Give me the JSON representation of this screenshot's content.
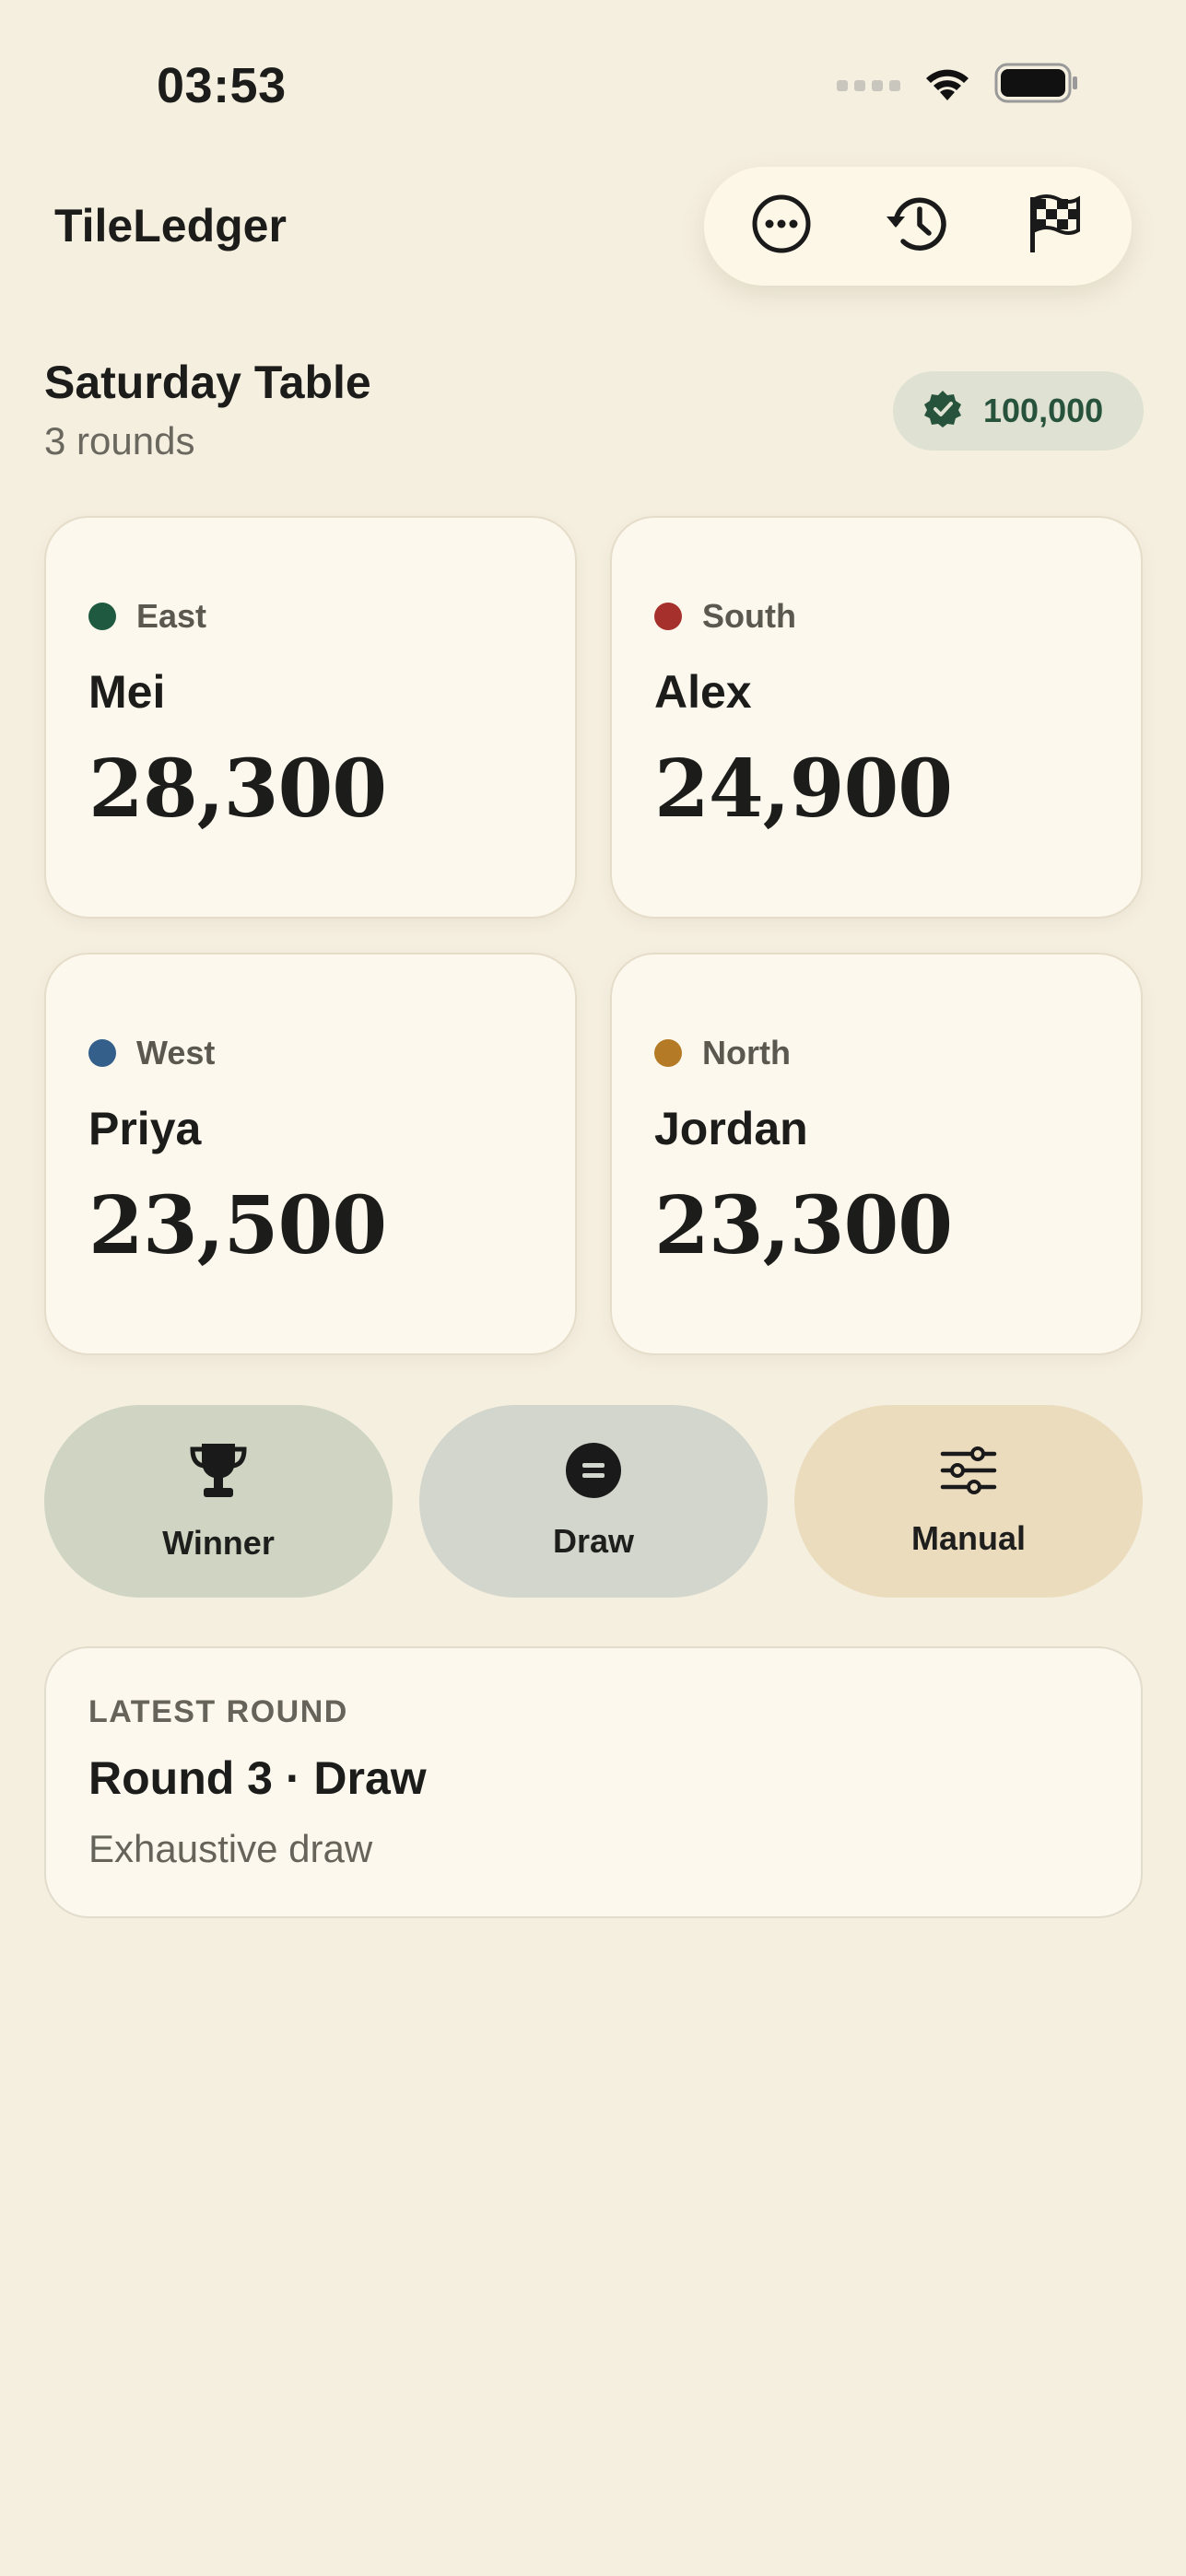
{
  "status_bar": {
    "time": "03:53"
  },
  "header": {
    "app_title": "TileLedger",
    "actions": [
      {
        "icon": "more-icon"
      },
      {
        "icon": "history-icon"
      },
      {
        "icon": "checkered-flag-icon"
      }
    ]
  },
  "session": {
    "title": "Saturday Table",
    "subtitle": "3 rounds",
    "target_badge": {
      "icon": "verified-badge-icon",
      "value": "100,000"
    }
  },
  "players": [
    {
      "wind": "East",
      "name": "Mei",
      "score": "28,300",
      "color": "#1f5a40"
    },
    {
      "wind": "South",
      "name": "Alex",
      "score": "24,900",
      "color": "#a6302b"
    },
    {
      "wind": "West",
      "name": "Priya",
      "score": "23,500",
      "color": "#335f8a"
    },
    {
      "wind": "North",
      "name": "Jordan",
      "score": "23,300",
      "color": "#b47a25"
    }
  ],
  "actions": [
    {
      "label": "Winner",
      "icon": "trophy-icon",
      "bg": "#cfd5c2"
    },
    {
      "label": "Draw",
      "icon": "equals-circle-icon",
      "bg": "#d3d6cd"
    },
    {
      "label": "Manual",
      "icon": "sliders-icon",
      "bg": "#ebdcbe"
    }
  ],
  "latest_round": {
    "kicker": "LATEST ROUND",
    "title": "Round 3 · Draw",
    "description": "Exhaustive draw"
  },
  "colors": {
    "background": "#f5efe0",
    "accent_green": "#27523c"
  }
}
